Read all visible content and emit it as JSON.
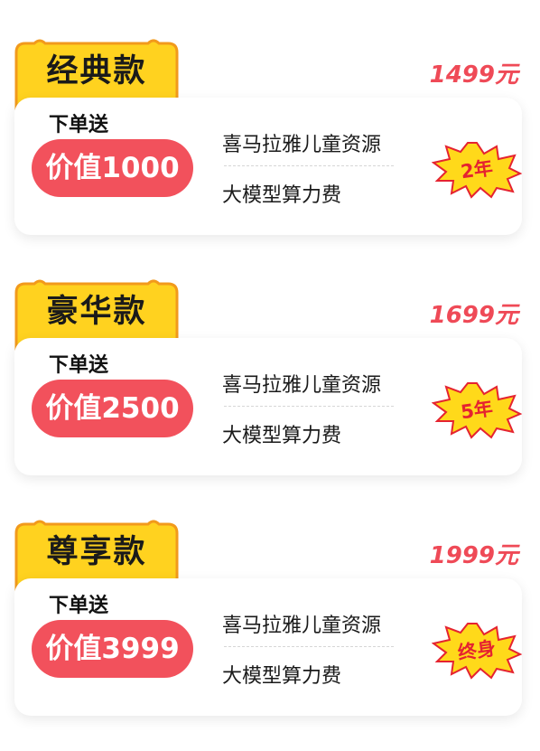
{
  "colors": {
    "accent_red": "#f2515c",
    "price_red": "#ef4a57",
    "tab_yellow": "#ffd21f",
    "tab_border": "#f29a1c",
    "badge_yellow": "#ffd91a"
  },
  "plans": [
    {
      "name": "经典款",
      "price": "1499元",
      "order_label": "下单送",
      "value": "价值1000",
      "benefit1": "喜马拉雅儿童资源",
      "benefit2": "大模型算力费",
      "duration": "2年"
    },
    {
      "name": "豪华款",
      "price": "1699元",
      "order_label": "下单送",
      "value": "价值2500",
      "benefit1": "喜马拉雅儿童资源",
      "benefit2": "大模型算力费",
      "duration": "5年"
    },
    {
      "name": "尊享款",
      "price": "1999元",
      "order_label": "下单送",
      "value": "价值3999",
      "benefit1": "喜马拉雅儿童资源",
      "benefit2": "大模型算力费",
      "duration": "终身"
    }
  ]
}
